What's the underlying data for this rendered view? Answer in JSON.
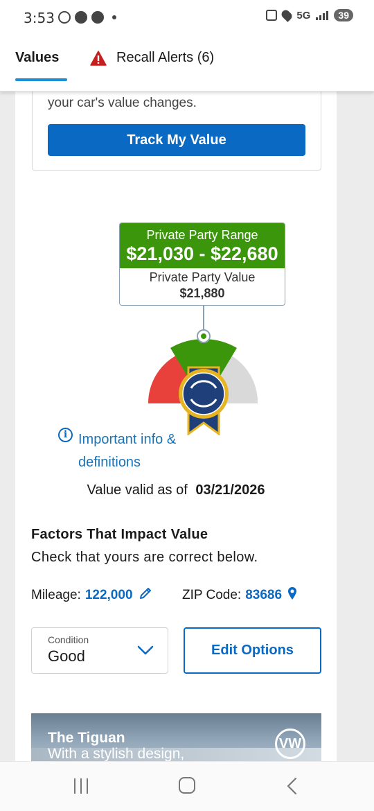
{
  "status_bar": {
    "time": "3:53",
    "network": "5G",
    "battery": "39"
  },
  "tabs": [
    {
      "label": "Values",
      "active": true
    },
    {
      "label": "Recall Alerts (6)",
      "active": false,
      "icon": "warning-icon"
    }
  ],
  "track": {
    "text": "your car's value changes.",
    "button_label": "Track My Value"
  },
  "valuation": {
    "range_label": "Private Party Range",
    "range_value": "$21,030 - $22,680",
    "value_label": "Private Party Value",
    "value": "$21,880"
  },
  "gauge": {
    "colors": {
      "low": "#e8413c",
      "mid": "#3c960c",
      "high": "#d9d9d9",
      "badge": "#1e3f7a",
      "badge_ring": "#e6b422"
    }
  },
  "info": {
    "link_text": "Important info & definitions"
  },
  "validity": {
    "label": "Value valid as of",
    "date": "03/21/2026"
  },
  "factors": {
    "title": "Factors That Impact Value",
    "subtitle": "Check that yours are correct below.",
    "mileage_label": "Mileage:",
    "mileage_value": "122,000",
    "zip_label": "ZIP Code:",
    "zip_value": "83686",
    "condition_label": "Condition",
    "condition_value": "Good",
    "edit_options_label": "Edit Options"
  },
  "ad": {
    "title": "The Tiguan",
    "subtitle": "With a stylish design,",
    "logo_text": "VW"
  },
  "colors": {
    "primary_blue": "#0a69c2",
    "range_green": "#3c960c"
  }
}
